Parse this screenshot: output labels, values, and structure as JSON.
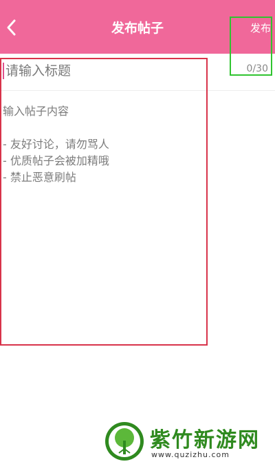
{
  "header": {
    "title": "发布帖子",
    "publish_label": "发布",
    "back_icon": "chevron-left-icon",
    "background_color": "#f0689a"
  },
  "form": {
    "title_placeholder": "请输入标题",
    "title_value": "",
    "counter": "0/30",
    "content_placeholder": "输入帖子内容\n\n- 友好讨论，请勿骂人\n- 优质帖子会被加精哦\n- 禁止恶意刷帖",
    "content_value": ""
  },
  "annotations": {
    "green_box_color": "#2fc42f",
    "red_box_color": "#d8334a"
  },
  "watermark": {
    "name": "紫竹新游网",
    "url": "www.quzizhu.com"
  }
}
